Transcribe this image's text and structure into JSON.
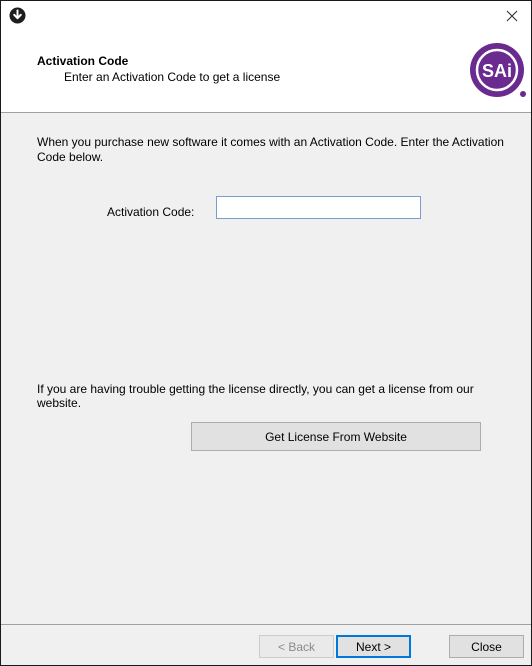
{
  "window": {
    "header": {
      "title": "Activation Code",
      "subtitle": "Enter an Activation Code to get a license",
      "logo_text": "SAi"
    }
  },
  "content": {
    "intro_text": "When you purchase new software it comes with an Activation Code.  Enter the Activation Code below.",
    "activation_code": {
      "label": "Activation Code:",
      "value": ""
    },
    "trouble_text": "If you are having trouble getting the license directly, you can get a license from our website.",
    "website_button_label": "Get License From Website"
  },
  "footer": {
    "back_label": "< Back",
    "next_label": "Next >",
    "close_label": "Close"
  },
  "colors": {
    "logo_purple": "#6a2a90",
    "input_border": "#7a9ccf",
    "focus_blue": "#0078d7",
    "panel_bg": "#f0f0f0"
  },
  "icons": {
    "app": "download-circle-icon",
    "close": "close-x-icon",
    "logo": "sai-logo"
  }
}
